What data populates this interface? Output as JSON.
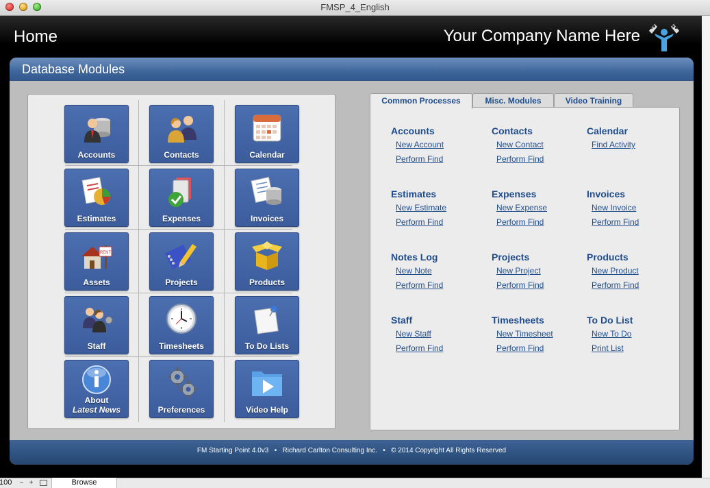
{
  "window": {
    "title": "FMSP_4_English"
  },
  "header": {
    "title": "Home",
    "company": "Your Company Name Here"
  },
  "panel": {
    "title": "Database Modules"
  },
  "modules": [
    {
      "label": "Accounts",
      "icon": "accounts-icon"
    },
    {
      "label": "Contacts",
      "icon": "contacts-icon"
    },
    {
      "label": "Calendar",
      "icon": "calendar-icon"
    },
    {
      "label": "Estimates",
      "icon": "estimates-icon"
    },
    {
      "label": "Expenses",
      "icon": "expenses-icon"
    },
    {
      "label": "Invoices",
      "icon": "invoices-icon"
    },
    {
      "label": "Assets",
      "icon": "assets-icon"
    },
    {
      "label": "Projects",
      "icon": "projects-icon"
    },
    {
      "label": "Products",
      "icon": "products-icon"
    },
    {
      "label": "Staff",
      "icon": "staff-icon"
    },
    {
      "label": "Timesheets",
      "icon": "timesheets-icon"
    },
    {
      "label": "To Do Lists",
      "icon": "todo-icon"
    },
    {
      "label": "About",
      "label2": "Latest News",
      "icon": "info-icon"
    },
    {
      "label": "Preferences",
      "icon": "gears-icon"
    },
    {
      "label": "Video Help",
      "icon": "video-icon"
    }
  ],
  "tabs": [
    {
      "label": "Common Processes",
      "active": true
    },
    {
      "label": "Misc. Modules",
      "active": false
    },
    {
      "label": "Video Training",
      "active": false
    }
  ],
  "processes": [
    {
      "title": "Accounts",
      "links": [
        "New Account",
        "Perform Find"
      ]
    },
    {
      "title": "Contacts",
      "links": [
        "New Contact",
        "Perform Find"
      ]
    },
    {
      "title": "Calendar",
      "links": [
        "Find Activity"
      ]
    },
    {
      "title": "Estimates",
      "links": [
        "New Estimate",
        "Perform Find"
      ]
    },
    {
      "title": "Expenses",
      "links": [
        "New Expense",
        "Perform Find"
      ]
    },
    {
      "title": "Invoices",
      "links": [
        "New Invoice",
        "Perform Find"
      ]
    },
    {
      "title": "Notes Log",
      "links": [
        "New Note",
        "Perform Find"
      ]
    },
    {
      "title": "Projects",
      "links": [
        "New Project",
        "Perform Find"
      ]
    },
    {
      "title": "Products",
      "links": [
        "New Product",
        "Perform Find"
      ]
    },
    {
      "title": "Staff",
      "links": [
        "New Staff",
        "Perform Find"
      ]
    },
    {
      "title": "Timesheets",
      "links": [
        "New Timesheet",
        "Perform Find"
      ]
    },
    {
      "title": "To Do List",
      "links": [
        "New To Do",
        "Print List"
      ]
    }
  ],
  "footer": {
    "text": "FM Starting Point 4.0v3   •   Richard Carlton Consulting Inc.   •   © 2014 Copyright All Rights Reserved"
  },
  "statusbar": {
    "zoom": "100",
    "mode": "Browse"
  }
}
